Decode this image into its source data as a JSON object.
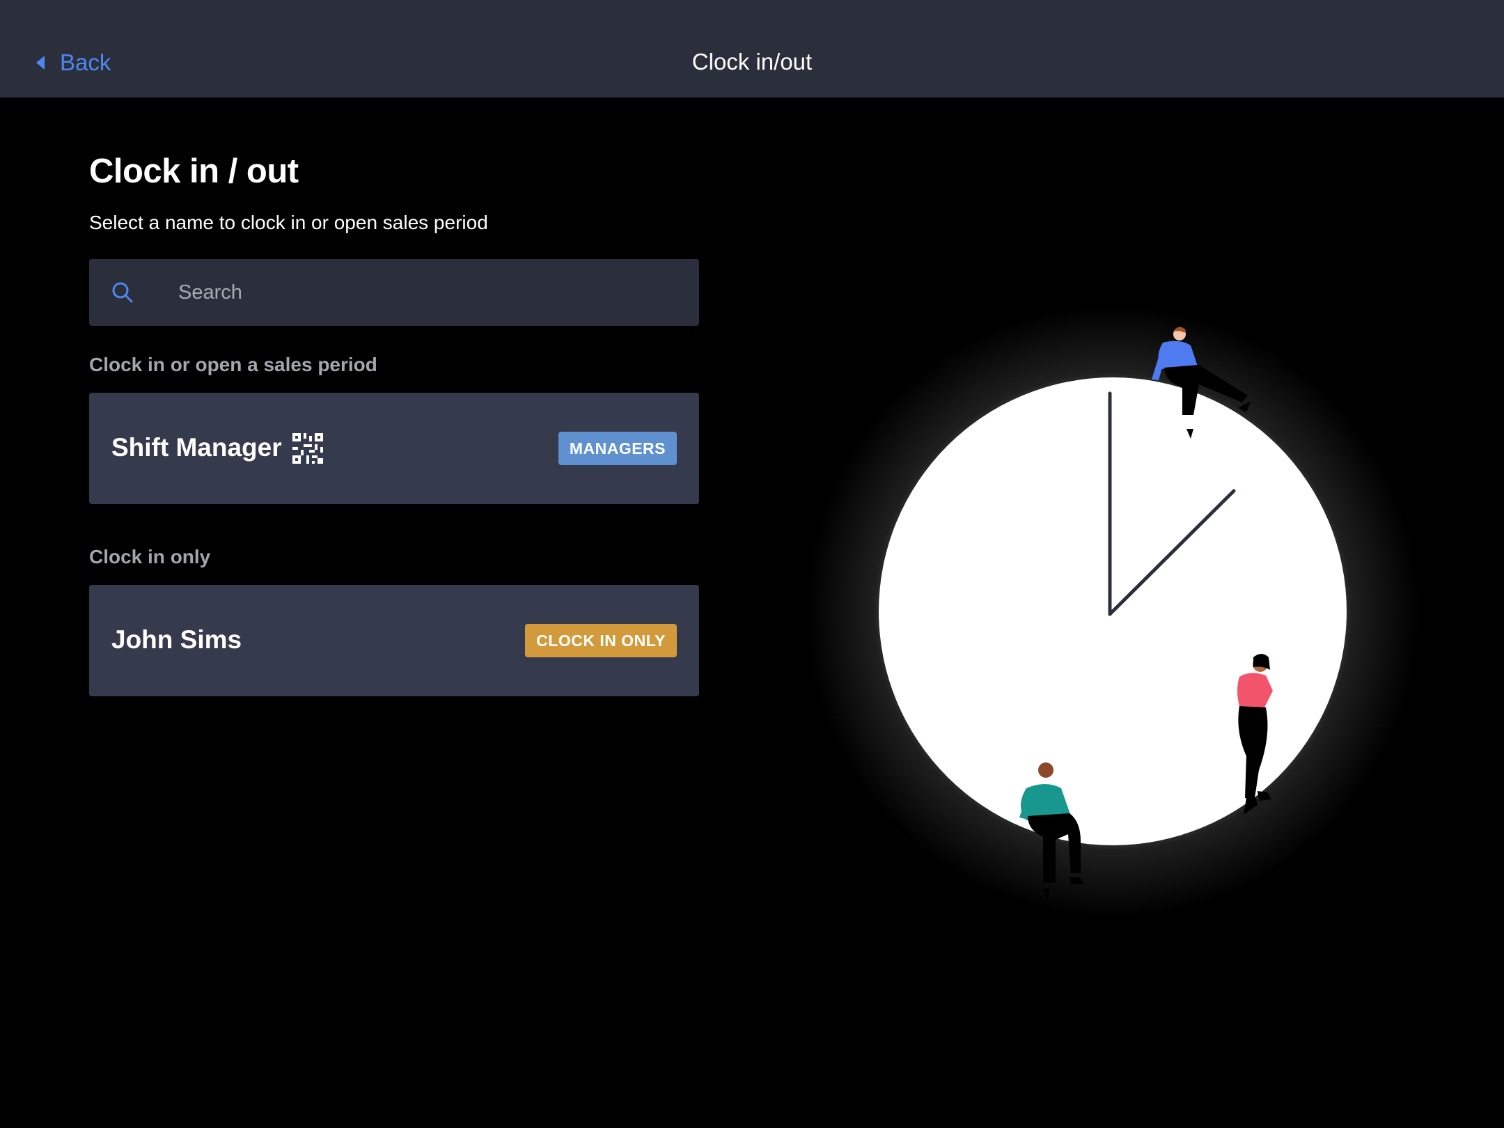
{
  "navbar": {
    "back_label": "Back",
    "title": "Clock in/out"
  },
  "page": {
    "title": "Clock in / out",
    "subtitle": "Select a name to clock in or open sales period"
  },
  "search": {
    "placeholder": "Search",
    "value": ""
  },
  "sections": [
    {
      "label": "Clock in or open a sales period",
      "items": [
        {
          "name": "Shift Manager",
          "badge": "MANAGERS",
          "badge_color": "#5f90d0",
          "icon": "qr-code-icon"
        }
      ]
    },
    {
      "label": "Clock in only",
      "items": [
        {
          "name": "John Sims",
          "badge": "CLOCK IN ONLY",
          "badge_color": "#d39a3c"
        }
      ]
    }
  ],
  "colors": {
    "navbar_bg": "#2b2f3c",
    "card_bg": "#363a4d",
    "accent": "#4f86f0"
  }
}
